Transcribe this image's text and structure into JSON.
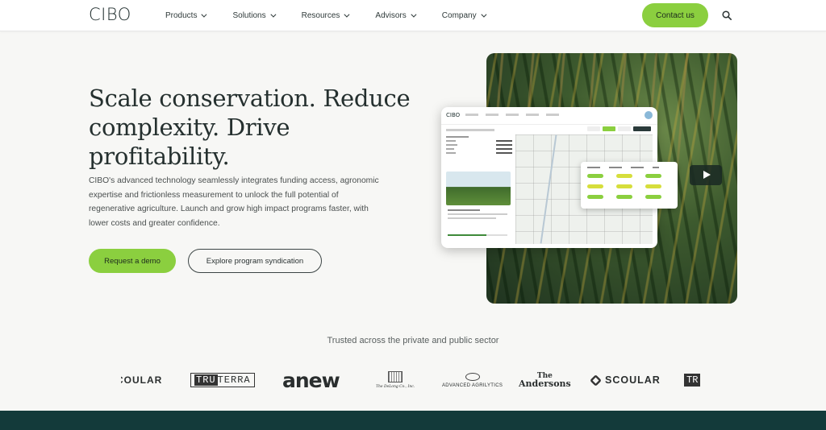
{
  "nav": {
    "logo": "CIBO",
    "items": [
      {
        "label": "Products"
      },
      {
        "label": "Solutions"
      },
      {
        "label": "Resources"
      },
      {
        "label": "Advisors"
      },
      {
        "label": "Company"
      }
    ],
    "contact_label": "Contact us",
    "search_icon": "search-icon"
  },
  "hero": {
    "title": "Scale conservation. Reduce complexity. Drive profitability.",
    "description": "CIBO's advanced technology seamlessly integrates funding access, agronomic expertise and frictionless measurement to unlock the full potential of regenerative agriculture. Launch and grow high impact programs faster, with lower costs and greater confidence.",
    "primary_button": "Request a demo",
    "secondary_button": "Explore program syndication",
    "play_icon": "play-icon"
  },
  "trusted": {
    "heading": "Trusted across the private and public sector",
    "logos": {
      "scoular_partial": "COULAR",
      "truterra_a": "TRU",
      "truterra_b": "TERRA",
      "anew": "anew",
      "delong": "The DeLong Co., Inc.",
      "advanced_agrilytics": "ADVANCED AGRILYTICS",
      "andersons_1": "The",
      "andersons_2": "Andersons",
      "scoular": "SCOULAR",
      "tru_partial": "TR"
    }
  },
  "colors": {
    "accent": "#8bcf3f",
    "dark": "#133a3a",
    "background": "#f7f7f5"
  }
}
